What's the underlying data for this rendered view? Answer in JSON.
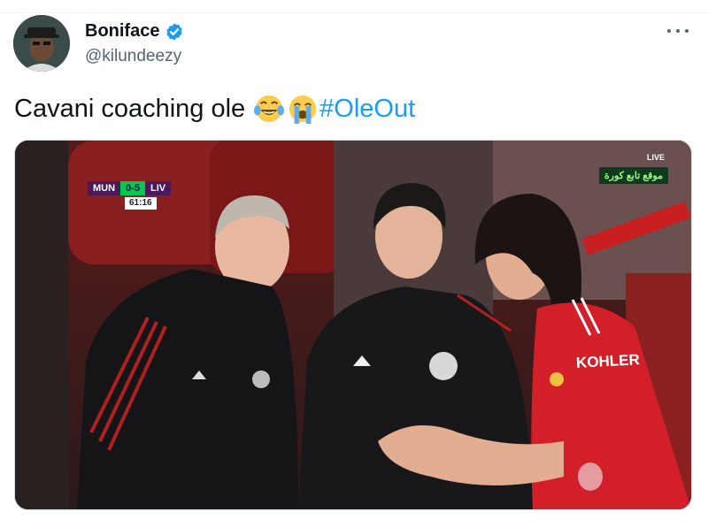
{
  "author": {
    "display_name": "Boniface",
    "handle": "@kilundeezy",
    "verified": true
  },
  "tweet": {
    "text": "Cavani coaching ole",
    "emojis": [
      "face-with-tears-of-joy",
      "loudly-crying-face"
    ],
    "hashtag": "#OleOut"
  },
  "media": {
    "scoreboard": {
      "home": "MUN",
      "score": "0-5",
      "away": "LIV",
      "clock": "61:16"
    },
    "broadcaster": "موقع تابع كورة",
    "live_badge": "LIVE",
    "shirt_sponsor": "KOHLER"
  },
  "colors": {
    "hashtag": "#1d9bf0",
    "verified": "#1d9bf0",
    "handle": "#536471"
  }
}
